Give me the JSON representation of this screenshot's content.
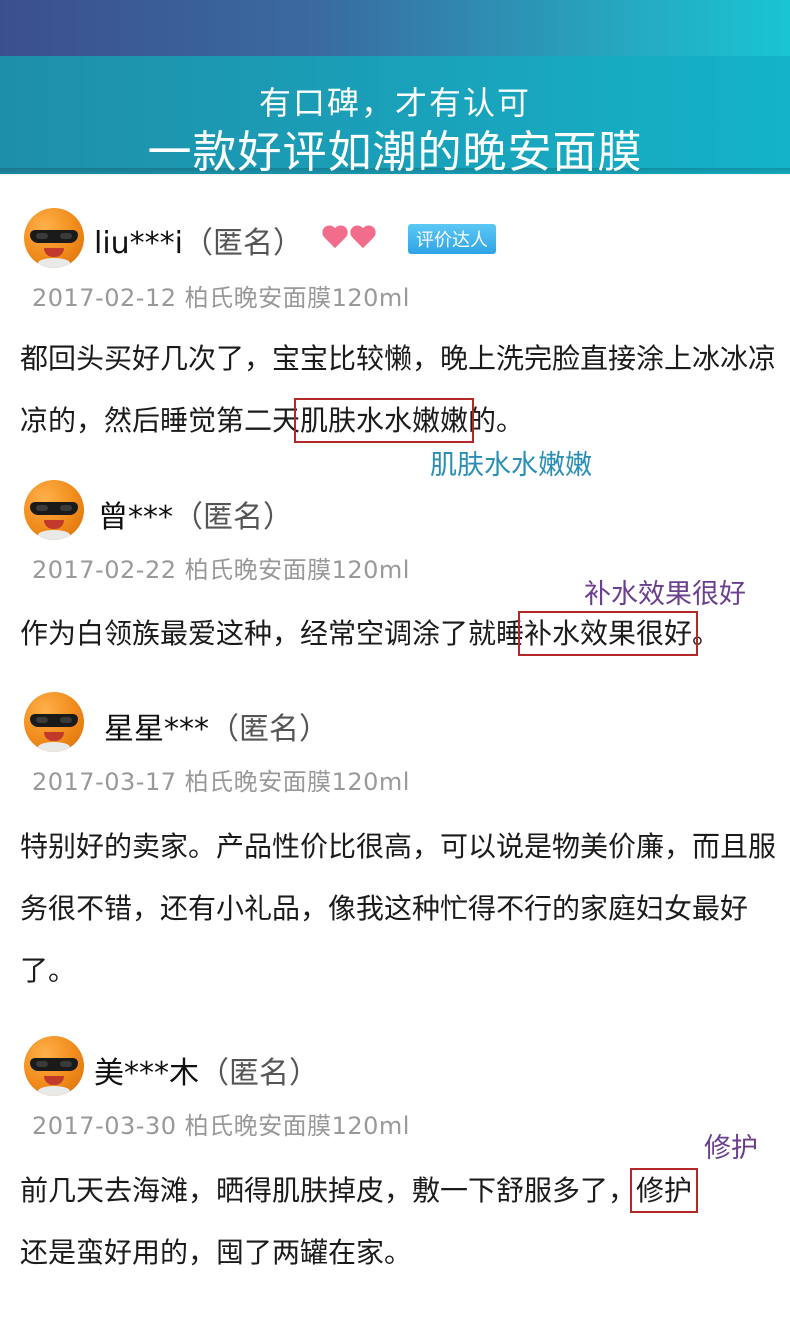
{
  "header": {
    "line1": "有口碑，才有认可",
    "line2": "一款好评如潮的晚安面膜"
  },
  "reviews": [
    {
      "user": "liu***i",
      "anon": "（匿名）",
      "badge": "评价达人",
      "date": "2017-02-12",
      "product": "柏氏晚安面膜120ml",
      "content_before": "都回头买好几次了，宝宝比较懒，晚上洗完脸直接涂上冰冰凉凉的，然后睡觉第二天",
      "highlight": "肌肤水水嫩嫩",
      "content_after": "的。",
      "note": "肌肤水水嫩嫩",
      "note_color": "#2a8fb5"
    },
    {
      "user": "曾***",
      "anon": "（匿名）",
      "date": "2017-02-22",
      "product": "柏氏晚安面膜120ml",
      "content_before": "作为白领族最爱这种，经常空调涂了就睡",
      "highlight": "补水效果很好",
      "content_after": "。",
      "note": "补水效果很好",
      "note_color": "#6b3f8f"
    },
    {
      "user": "星星***",
      "anon": "（匿名）",
      "date": "2017-03-17",
      "product": "柏氏晚安面膜120ml",
      "content": "特别好的卖家。产品性价比很高，可以说是物美价廉，而且服务很不错，还有小礼品，像我这种忙得不行的家庭妇女最好了。"
    },
    {
      "user": "美***木",
      "anon": "（匿名）",
      "date": "2017-03-30",
      "product": "柏氏晚安面膜120ml",
      "content_before": "前几天去海滩，晒得肌肤掉皮，敷一下舒服多了，",
      "highlight": "修护",
      "content_after": "还是蛮好用的，囤了两罐在家。",
      "note": "修护",
      "note_color": "#6b3f8f"
    }
  ]
}
